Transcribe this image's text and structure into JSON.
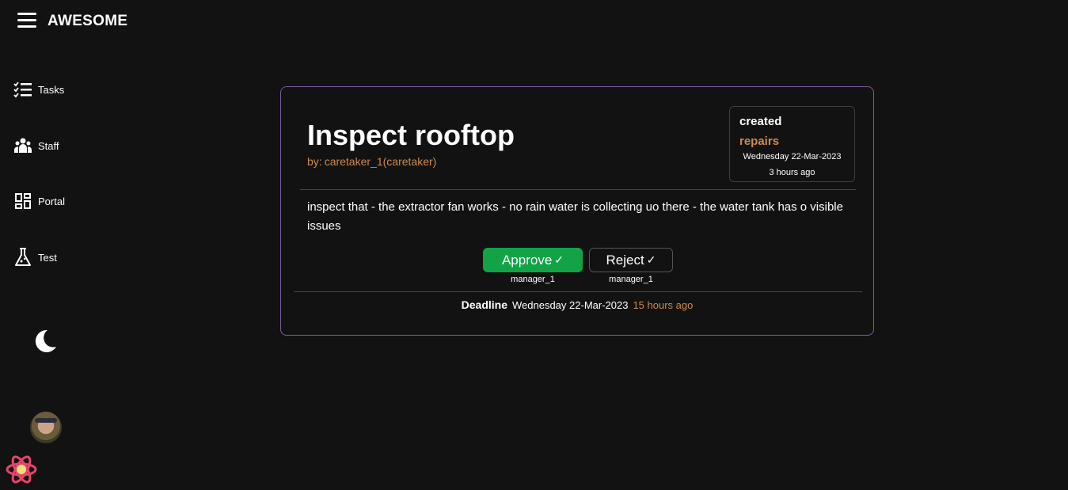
{
  "app": {
    "title": "AWESOME"
  },
  "sidebar": {
    "items": [
      {
        "label": "Tasks",
        "icon": "tasks-checklist-icon"
      },
      {
        "label": "Staff",
        "icon": "staff-group-icon"
      },
      {
        "label": "Portal",
        "icon": "portal-dashboard-icon"
      },
      {
        "label": "Test",
        "icon": "flask-icon"
      }
    ]
  },
  "task": {
    "title": "Inspect rooftop",
    "author_prefix": "by:",
    "author": "caretaker_1(caretaker)",
    "status": "created",
    "category": "repairs",
    "created_date": "Wednesday 22-Mar-2023",
    "created_ago": "3 hours ago",
    "description": "inspect that - the extractor fan works - no rain water is collecting uo there - the water tank has o visible issues",
    "approve_label": "Approve",
    "reject_label": "Reject",
    "check_mark": "✓",
    "approve_user": "manager_1",
    "reject_user": "manager_1",
    "deadline_label": "Deadline",
    "deadline_date": "Wednesday 22-Mar-2023",
    "deadline_ago": "15 hours ago"
  },
  "colors": {
    "accent_orange": "#d08a4a",
    "approve_green": "#12a347",
    "card_border": "#7d5b9e",
    "background": "#121212"
  }
}
